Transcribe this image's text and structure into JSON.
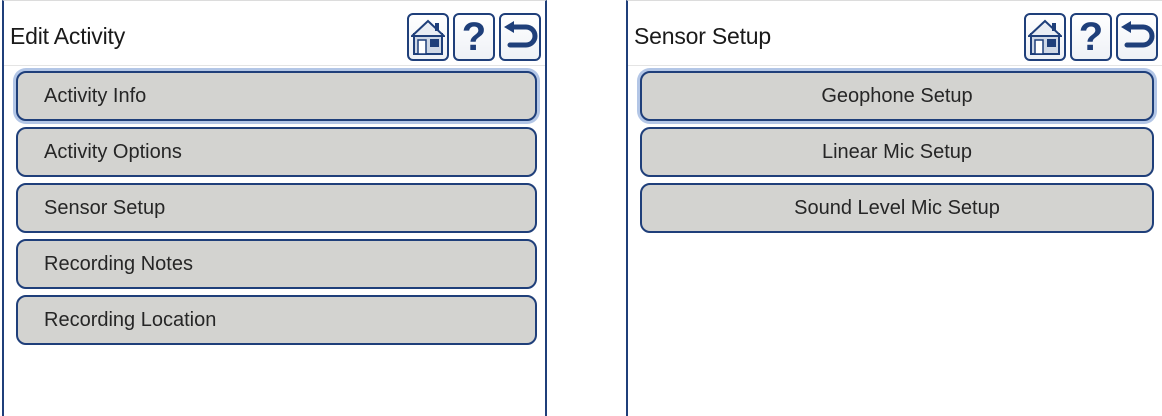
{
  "left_panel": {
    "title": "Edit Activity",
    "header_icons": [
      "home-icon",
      "help-icon",
      "back-icon"
    ],
    "help_glyph": "?",
    "items": [
      {
        "label": "Activity Info"
      },
      {
        "label": "Activity Options"
      },
      {
        "label": "Sensor Setup"
      },
      {
        "label": "Recording Notes"
      },
      {
        "label": "Recording Location"
      }
    ]
  },
  "right_panel": {
    "title": "Sensor Setup",
    "header_icons": [
      "home-icon",
      "help-icon",
      "back-icon"
    ],
    "help_glyph": "?",
    "items": [
      {
        "label": "Geophone Setup"
      },
      {
        "label": "Linear Mic Setup"
      },
      {
        "label": "Sound Level Mic Setup"
      }
    ]
  },
  "colors": {
    "border": "#1f3f7a",
    "button_fill": "#d3d3d0",
    "focus_ring": "#b3c6e6"
  }
}
